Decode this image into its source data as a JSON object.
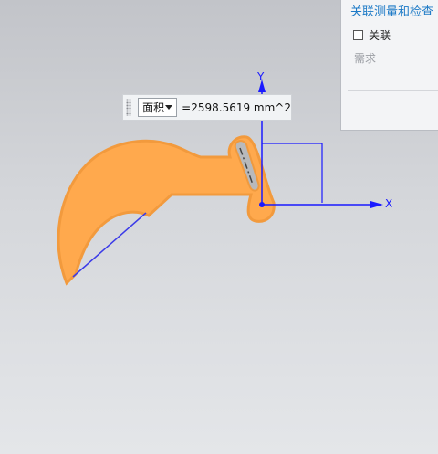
{
  "panel": {
    "title": "关联测量和检查",
    "associative_label": "关联",
    "associative_checked": false,
    "requirements_label": "需求"
  },
  "measure": {
    "type_selected": "面积",
    "value_text": "=2598.5619 mm^2"
  },
  "axes": {
    "x_label": "X",
    "y_label": "Y",
    "color": "#1a1aff"
  },
  "colors": {
    "part_fill": "#ffa94d",
    "part_edge": "#f29a3d",
    "slot_fill": "#b8b9bb"
  }
}
